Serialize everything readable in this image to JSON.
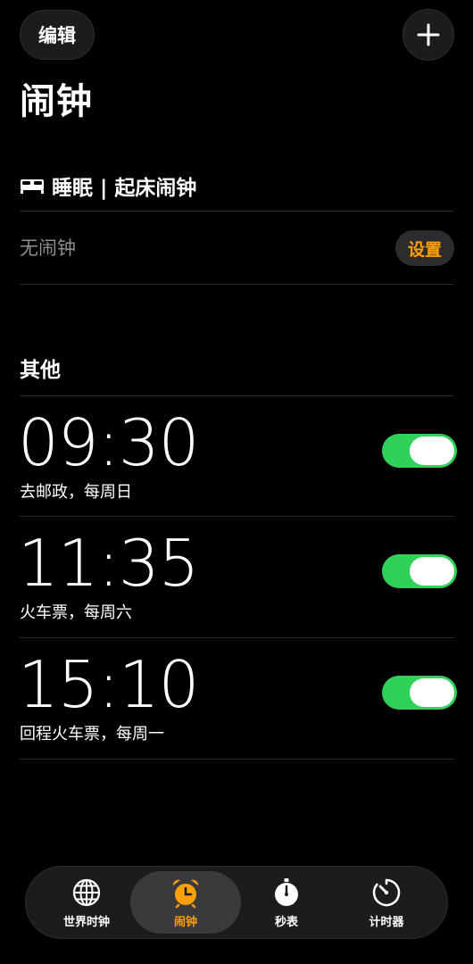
{
  "header": {
    "edit_label": "编辑",
    "add_icon": "plus-icon",
    "title": "闹钟"
  },
  "sleep": {
    "icon": "bed-icon",
    "title": "睡眠 | 起床闹钟",
    "empty_text": "无闹钟",
    "setup_label": "设置"
  },
  "other": {
    "title": "其他",
    "alarms": [
      {
        "time": "09:30",
        "label": "去邮政，每周日",
        "enabled": true
      },
      {
        "time": "11:35",
        "label": "火车票，每周六",
        "enabled": true
      },
      {
        "time": "15:10",
        "label": "回程火车票，每周一",
        "enabled": true
      }
    ]
  },
  "tabbar": {
    "tabs": [
      {
        "label": "世界时钟",
        "icon": "globe-icon",
        "active": false
      },
      {
        "label": "闹钟",
        "icon": "alarm-clock-icon",
        "active": true
      },
      {
        "label": "秒表",
        "icon": "stopwatch-icon",
        "active": false
      },
      {
        "label": "计时器",
        "icon": "timer-icon",
        "active": false
      }
    ]
  },
  "colors": {
    "accent": "#ff9f0a",
    "toggle_on": "#30d158",
    "background": "#000000",
    "secondary_text": "#8e8e93"
  }
}
